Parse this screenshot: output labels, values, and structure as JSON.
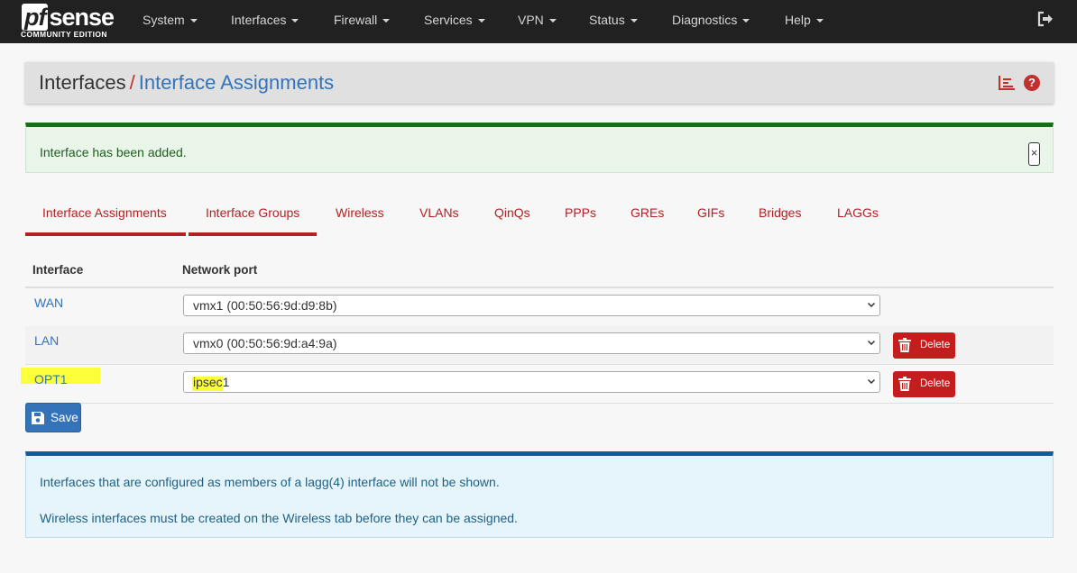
{
  "brand": {
    "main": "sense",
    "pf": "pf",
    "sub": "COMMUNITY EDITION"
  },
  "nav": {
    "items": [
      {
        "label": "System"
      },
      {
        "label": "Interfaces"
      },
      {
        "label": "Firewall"
      },
      {
        "label": "Services"
      },
      {
        "label": "VPN"
      },
      {
        "label": "Status"
      },
      {
        "label": "Diagnostics"
      },
      {
        "label": "Help"
      }
    ]
  },
  "header": {
    "parent": "Interfaces",
    "separator": "/",
    "current": "Interface Assignments",
    "help": "?"
  },
  "alert_success": {
    "text": "Interface has been added.",
    "close": "×"
  },
  "tabs": [
    {
      "label": "Interface Assignments"
    },
    {
      "label": "Interface Groups"
    },
    {
      "label": "Wireless"
    },
    {
      "label": "VLANs"
    },
    {
      "label": "QinQs"
    },
    {
      "label": "PPPs"
    },
    {
      "label": "GREs"
    },
    {
      "label": "GIFs"
    },
    {
      "label": "Bridges"
    },
    {
      "label": "LAGGs"
    }
  ],
  "table": {
    "headers": {
      "interface": "Interface",
      "port": "Network port"
    },
    "rows": [
      {
        "name": "WAN",
        "port": "vmx1 (00:50:56:9d:d9:8b)"
      },
      {
        "name": "LAN",
        "port": "vmx0 (00:50:56:9d:a4:9a)",
        "delete": "Delete"
      },
      {
        "name": "OPT1",
        "port": "ipsec1",
        "delete": "Delete"
      }
    ]
  },
  "save_label": "Save",
  "alert_info": {
    "line1": "Interfaces that are configured as members of a lagg(4) interface will not be shown.",
    "line2": "Wireless interfaces must be created on the Wireless tab before they can be assigned."
  },
  "colors": {
    "accent": "#3473b8",
    "danger": "#c41d1d",
    "tab": "#b22222",
    "highlight": "#fbff3a"
  }
}
